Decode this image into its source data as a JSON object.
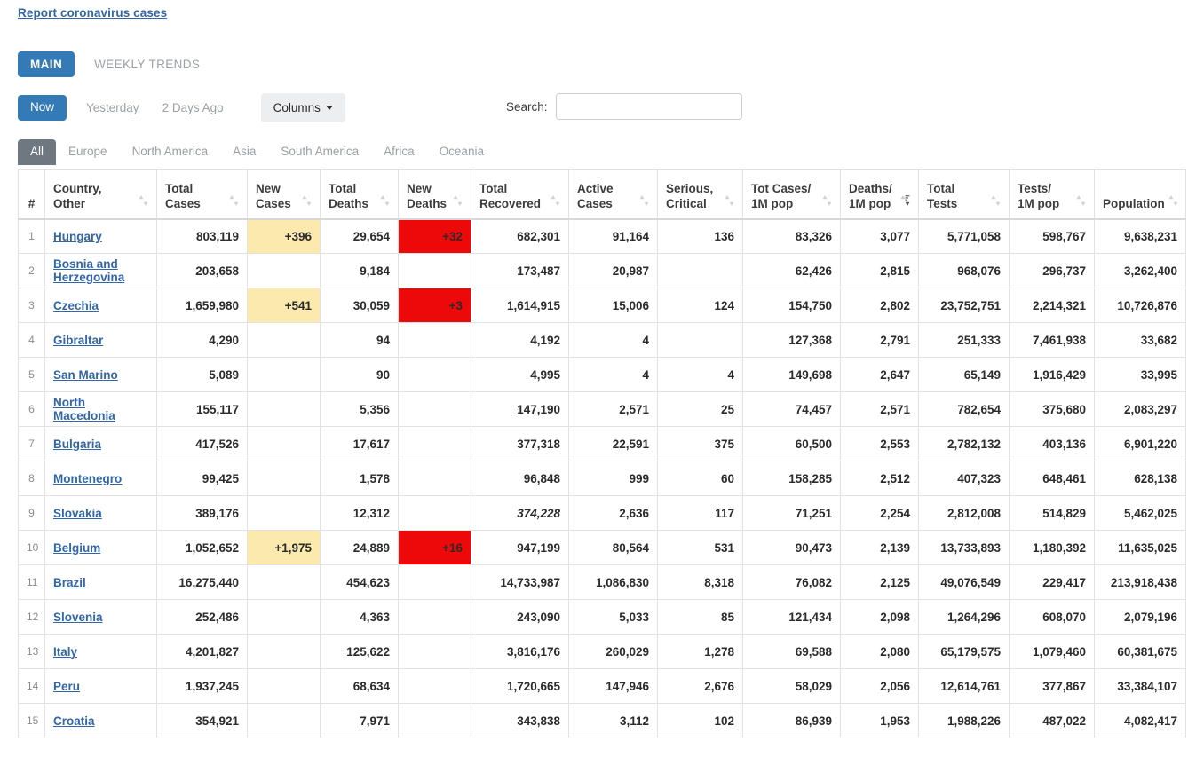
{
  "report_link": "Report coronavirus cases",
  "view_tabs": [
    {
      "label": "MAIN",
      "active": true
    },
    {
      "label": "WEEKLY TRENDS",
      "active": false
    }
  ],
  "day_tabs": [
    {
      "label": "Now",
      "active": true
    },
    {
      "label": "Yesterday",
      "active": false
    },
    {
      "label": "2 Days Ago",
      "active": false
    }
  ],
  "columns_button": "Columns",
  "search": {
    "label": "Search:",
    "value": "",
    "placeholder": ""
  },
  "continent_tabs": [
    {
      "label": "All",
      "active": true
    },
    {
      "label": "Europe",
      "active": false
    },
    {
      "label": "North America",
      "active": false
    },
    {
      "label": "Asia",
      "active": false
    },
    {
      "label": "South America",
      "active": false
    },
    {
      "label": "Africa",
      "active": false
    },
    {
      "label": "Oceania",
      "active": false
    }
  ],
  "table": {
    "headers": [
      {
        "label": "#",
        "sort": "none"
      },
      {
        "label": "Country,\nOther",
        "sort": "both"
      },
      {
        "label": "Total\nCases",
        "sort": "both"
      },
      {
        "label": "New\nCases",
        "sort": "both"
      },
      {
        "label": "Total\nDeaths",
        "sort": "both"
      },
      {
        "label": "New\nDeaths",
        "sort": "both"
      },
      {
        "label": "Total\nRecovered",
        "sort": "both"
      },
      {
        "label": "Active\nCases",
        "sort": "both"
      },
      {
        "label": "Serious,\nCritical",
        "sort": "both"
      },
      {
        "label": "Tot Cases/\n1M pop",
        "sort": "both"
      },
      {
        "label": "Deaths/\n1M pop",
        "sort": "desc"
      },
      {
        "label": "Total\nTests",
        "sort": "both"
      },
      {
        "label": "Tests/\n1M pop",
        "sort": "both"
      },
      {
        "label": "Population",
        "sort": "both"
      }
    ],
    "rows": [
      {
        "n": "1",
        "country": "Hungary",
        "total_cases": "803,119",
        "new_cases": "+396",
        "total_deaths": "29,654",
        "new_deaths": "+32",
        "total_recovered": "682,301",
        "active_cases": "91,164",
        "serious": "136",
        "cases_1m": "83,326",
        "deaths_1m": "3,077",
        "total_tests": "5,771,058",
        "tests_1m": "598,767",
        "population": "9,638,231"
      },
      {
        "n": "2",
        "country": "Bosnia and Herzegovina",
        "total_cases": "203,658",
        "new_cases": "",
        "total_deaths": "9,184",
        "new_deaths": "",
        "total_recovered": "173,487",
        "active_cases": "20,987",
        "serious": "",
        "cases_1m": "62,426",
        "deaths_1m": "2,815",
        "total_tests": "968,076",
        "tests_1m": "296,737",
        "population": "3,262,400"
      },
      {
        "n": "3",
        "country": "Czechia",
        "total_cases": "1,659,980",
        "new_cases": "+541",
        "total_deaths": "30,059",
        "new_deaths": "+3",
        "total_recovered": "1,614,915",
        "active_cases": "15,006",
        "serious": "124",
        "cases_1m": "154,750",
        "deaths_1m": "2,802",
        "total_tests": "23,752,751",
        "tests_1m": "2,214,321",
        "population": "10,726,876"
      },
      {
        "n": "4",
        "country": "Gibraltar",
        "total_cases": "4,290",
        "new_cases": "",
        "total_deaths": "94",
        "new_deaths": "",
        "total_recovered": "4,192",
        "active_cases": "4",
        "serious": "",
        "cases_1m": "127,368",
        "deaths_1m": "2,791",
        "total_tests": "251,333",
        "tests_1m": "7,461,938",
        "population": "33,682"
      },
      {
        "n": "5",
        "country": "San Marino",
        "total_cases": "5,089",
        "new_cases": "",
        "total_deaths": "90",
        "new_deaths": "",
        "total_recovered": "4,995",
        "active_cases": "4",
        "serious": "4",
        "cases_1m": "149,698",
        "deaths_1m": "2,647",
        "total_tests": "65,149",
        "tests_1m": "1,916,429",
        "population": "33,995"
      },
      {
        "n": "6",
        "country": "North Macedonia",
        "total_cases": "155,117",
        "new_cases": "",
        "total_deaths": "5,356",
        "new_deaths": "",
        "total_recovered": "147,190",
        "active_cases": "2,571",
        "serious": "25",
        "cases_1m": "74,457",
        "deaths_1m": "2,571",
        "total_tests": "782,654",
        "tests_1m": "375,680",
        "population": "2,083,297"
      },
      {
        "n": "7",
        "country": "Bulgaria",
        "total_cases": "417,526",
        "new_cases": "",
        "total_deaths": "17,617",
        "new_deaths": "",
        "total_recovered": "377,318",
        "active_cases": "22,591",
        "serious": "375",
        "cases_1m": "60,500",
        "deaths_1m": "2,553",
        "total_tests": "2,782,132",
        "tests_1m": "403,136",
        "population": "6,901,220"
      },
      {
        "n": "8",
        "country": "Montenegro",
        "total_cases": "99,425",
        "new_cases": "",
        "total_deaths": "1,578",
        "new_deaths": "",
        "total_recovered": "96,848",
        "active_cases": "999",
        "serious": "60",
        "cases_1m": "158,285",
        "deaths_1m": "2,512",
        "total_tests": "407,323",
        "tests_1m": "648,461",
        "population": "628,138"
      },
      {
        "n": "9",
        "country": "Slovakia",
        "total_cases": "389,176",
        "new_cases": "",
        "total_deaths": "12,312",
        "new_deaths": "",
        "total_recovered": "374,228",
        "recovered_dim": true,
        "active_cases": "2,636",
        "serious": "117",
        "cases_1m": "71,251",
        "deaths_1m": "2,254",
        "total_tests": "2,812,008",
        "tests_1m": "514,829",
        "population": "5,462,025"
      },
      {
        "n": "10",
        "country": "Belgium",
        "total_cases": "1,052,652",
        "new_cases": "+1,975",
        "total_deaths": "24,889",
        "new_deaths": "+16",
        "total_recovered": "947,199",
        "active_cases": "80,564",
        "serious": "531",
        "cases_1m": "90,473",
        "deaths_1m": "2,139",
        "total_tests": "13,733,893",
        "tests_1m": "1,180,392",
        "population": "11,635,025"
      },
      {
        "n": "11",
        "country": "Brazil",
        "total_cases": "16,275,440",
        "new_cases": "",
        "total_deaths": "454,623",
        "new_deaths": "",
        "total_recovered": "14,733,987",
        "active_cases": "1,086,830",
        "serious": "8,318",
        "cases_1m": "76,082",
        "deaths_1m": "2,125",
        "total_tests": "49,076,549",
        "tests_1m": "229,417",
        "population": "213,918,438"
      },
      {
        "n": "12",
        "country": "Slovenia",
        "total_cases": "252,486",
        "new_cases": "",
        "total_deaths": "4,363",
        "new_deaths": "",
        "total_recovered": "243,090",
        "active_cases": "5,033",
        "serious": "85",
        "cases_1m": "121,434",
        "deaths_1m": "2,098",
        "total_tests": "1,264,296",
        "tests_1m": "608,070",
        "population": "2,079,196"
      },
      {
        "n": "13",
        "country": "Italy",
        "total_cases": "4,201,827",
        "new_cases": "",
        "total_deaths": "125,622",
        "new_deaths": "",
        "total_recovered": "3,816,176",
        "active_cases": "260,029",
        "serious": "1,278",
        "cases_1m": "69,588",
        "deaths_1m": "2,080",
        "total_tests": "65,179,575",
        "tests_1m": "1,079,460",
        "population": "60,381,675"
      },
      {
        "n": "14",
        "country": "Peru",
        "total_cases": "1,937,245",
        "new_cases": "",
        "total_deaths": "68,634",
        "new_deaths": "",
        "total_recovered": "1,720,665",
        "active_cases": "147,946",
        "serious": "2,676",
        "cases_1m": "58,029",
        "deaths_1m": "2,056",
        "total_tests": "12,614,761",
        "tests_1m": "377,867",
        "population": "33,384,107"
      },
      {
        "n": "15",
        "country": "Croatia",
        "total_cases": "354,921",
        "new_cases": "",
        "total_deaths": "7,971",
        "new_deaths": "",
        "total_recovered": "343,838",
        "active_cases": "3,112",
        "serious": "102",
        "cases_1m": "86,939",
        "deaths_1m": "1,953",
        "total_tests": "1,988,226",
        "tests_1m": "487,022",
        "population": "4,082,417"
      }
    ]
  },
  "colors": {
    "accent_blue": "#337ab7",
    "link_blue": "#3266a8",
    "population_blue": "#3775b3",
    "new_cases_bg": "#fbe9ae",
    "new_deaths_bg": "#ed0909",
    "active_tab_grey": "#6f7780"
  }
}
